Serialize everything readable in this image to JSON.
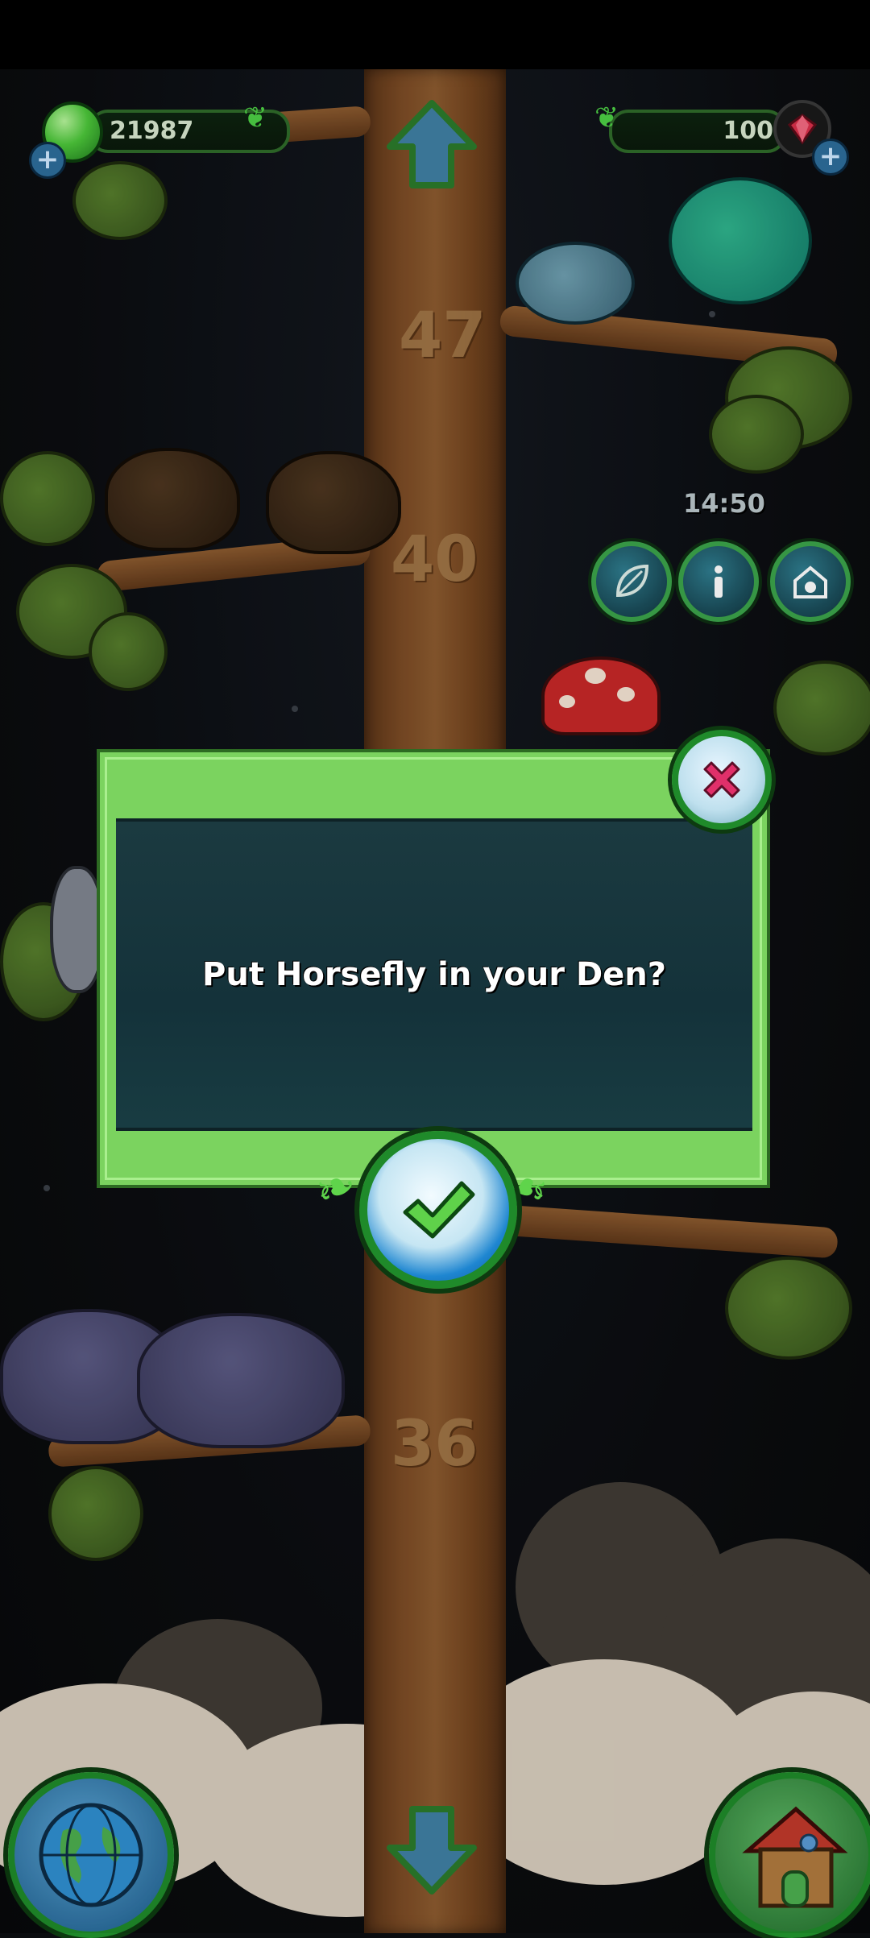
{
  "hud": {
    "dna_amount": "21987",
    "gem_amount": "100",
    "clock": "14:50"
  },
  "tree": {
    "floor_numbers": [
      "47",
      "40",
      "36"
    ]
  },
  "dialog": {
    "message": "Put Horsefly in your Den?"
  },
  "icons": {
    "nav_up": "up-arrow-icon",
    "nav_down": "down-arrow-icon",
    "leaf": "leaf-icon",
    "info": "info-icon",
    "den": "den-icon",
    "globe": "globe-icon",
    "house": "house-icon",
    "close": "close-x-icon",
    "confirm": "checkmark-icon"
  },
  "colors": {
    "dialog_green": "#7bd35f",
    "dialog_panel": "#1b3a40",
    "trunk": "#7a4a24",
    "ring_green": "#1f8a2a"
  }
}
